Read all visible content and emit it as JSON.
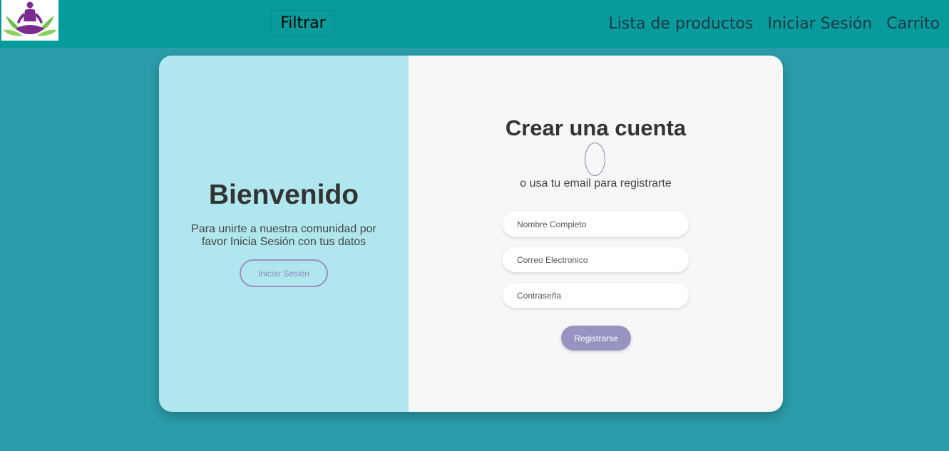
{
  "navbar": {
    "logo_icon": "yoga-meditation-logo-icon",
    "filter_label": "Filtrar",
    "links": [
      "Lista de productos",
      "Iniciar Sesión",
      "Carrito"
    ]
  },
  "welcome": {
    "title": "Bienvenido",
    "text": "Para unirte a nuestra comunidad por favor Inicia Sesión con tus datos",
    "login_label": "Iniciar Sesión"
  },
  "signup": {
    "title": "Crear una cuenta",
    "subtitle": "o usa tu email para registrarte",
    "name_placeholder": "Nombre Completo",
    "email_placeholder": "Correo Electronico",
    "password_placeholder": "Contraseña",
    "register_label": "Registrarse"
  },
  "colors": {
    "navbar": "#089b9b",
    "page_background": "#2a9ba8",
    "left_panel": "#b0e7ee",
    "accent_purple": "#9894c2"
  }
}
